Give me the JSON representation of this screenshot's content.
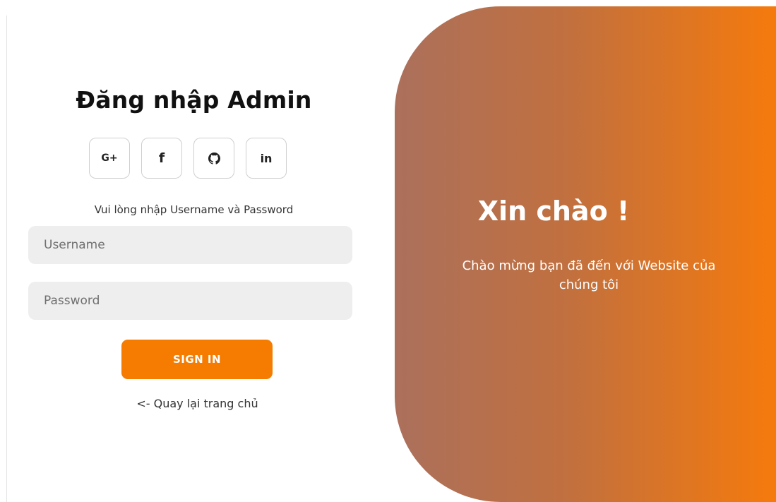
{
  "login": {
    "title": "Đăng nhập Admin",
    "social": [
      {
        "label": "G+",
        "icon": "google-plus-icon"
      },
      {
        "label": "f",
        "icon": "facebook-icon"
      },
      {
        "label": "",
        "icon": "github-icon"
      },
      {
        "label": "in",
        "icon": "linkedin-icon"
      }
    ],
    "hint": "Vui lòng nhập Username và Password",
    "username_placeholder": "Username",
    "username_value": "",
    "password_placeholder": "Password",
    "password_value": "",
    "signin_label": "SIGN IN",
    "back_link": "<- Quay lại trang chủ"
  },
  "hero": {
    "title": "Xin chào !",
    "text": "Chào mừng bạn đã đến với Website của chúng tôi"
  },
  "colors": {
    "accent": "#f57c00",
    "gradient_start": "#ab705c",
    "gradient_end": "#f57a0c",
    "input_bg": "#eeeeee"
  }
}
